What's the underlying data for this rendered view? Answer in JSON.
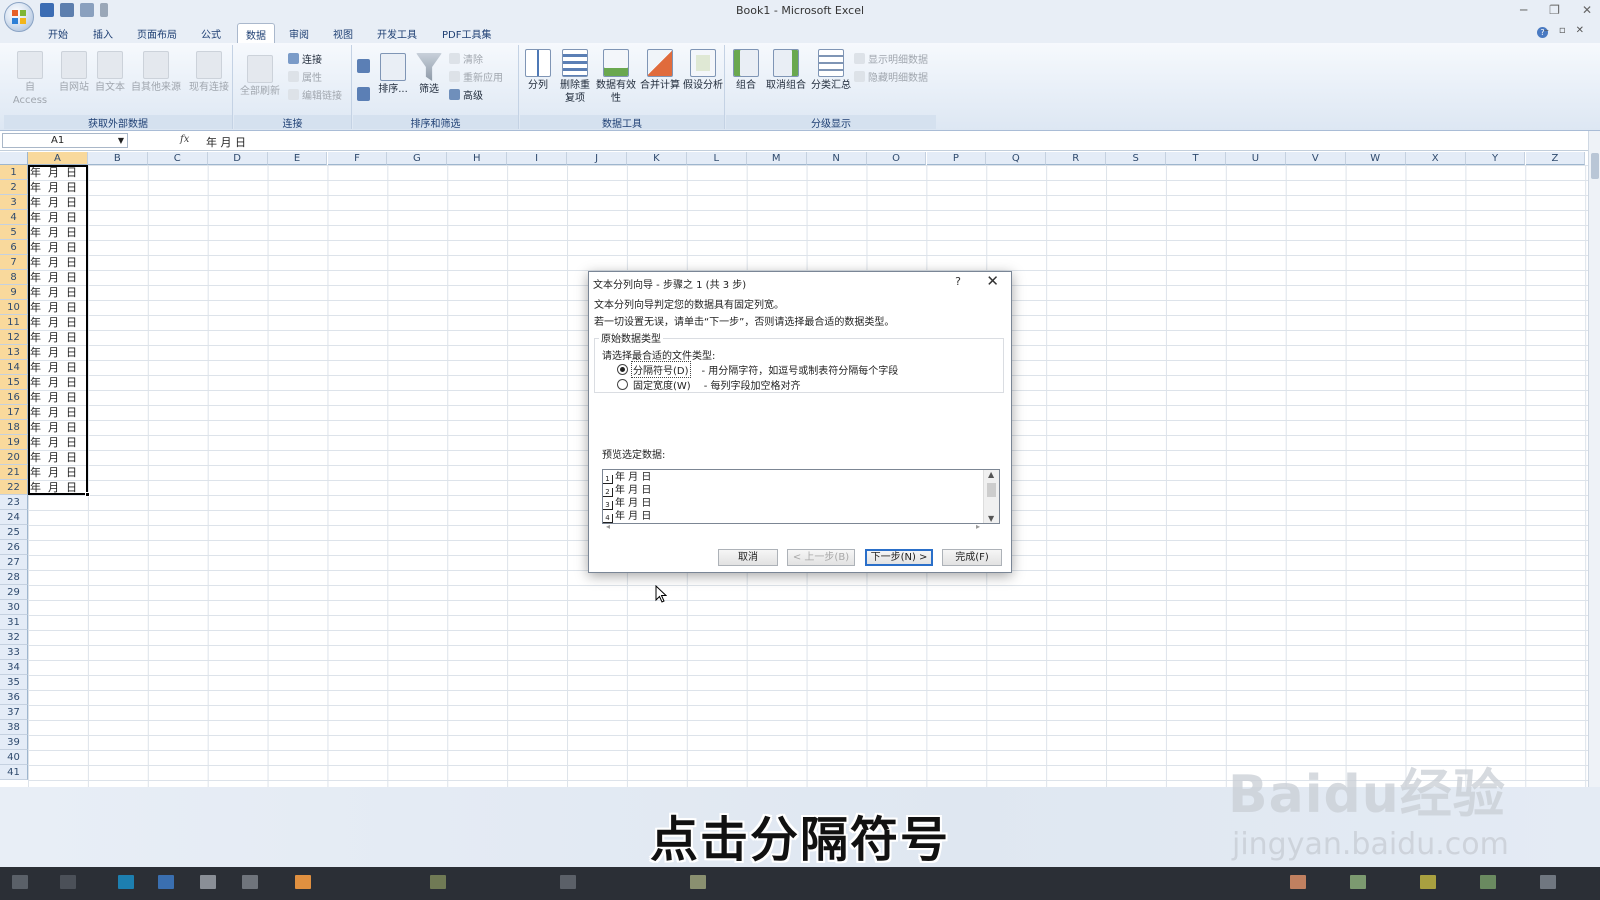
{
  "window": {
    "title": "Book1 - Microsoft Excel"
  },
  "ribbon_tabs": [
    "开始",
    "插入",
    "页面布局",
    "公式",
    "数据",
    "审阅",
    "视图",
    "开发工具",
    "PDF工具集"
  ],
  "active_tab": "数据",
  "ribbon": {
    "external": {
      "label": "获取外部数据",
      "buttons": [
        "自 Access",
        "自网站",
        "自文本",
        "自其他来源",
        "现有连接"
      ]
    },
    "connections": {
      "label": "连接",
      "refresh_all": "全部刷新",
      "items": [
        "连接",
        "属性",
        "编辑链接"
      ]
    },
    "sort_filter": {
      "label": "排序和筛选",
      "sort": "排序...",
      "filter": "筛选",
      "items": [
        "清除",
        "重新应用",
        "高级"
      ]
    },
    "data_tools": {
      "label": "数据工具",
      "buttons": [
        "分列",
        "删除重复项",
        "数据有效性",
        "合并计算",
        "假设分析"
      ]
    },
    "outline": {
      "label": "分级显示",
      "buttons": [
        "组合",
        "取消组合",
        "分类汇总"
      ],
      "items": [
        "显示明细数据",
        "隐藏明细数据"
      ]
    }
  },
  "formula_bar": {
    "name_box": "A1",
    "fx": "fx",
    "content": "年 月 日"
  },
  "columns": [
    "A",
    "B",
    "C",
    "D",
    "E",
    "F",
    "G",
    "H",
    "I",
    "J",
    "K",
    "L",
    "M",
    "N",
    "O",
    "P",
    "Q",
    "R",
    "S",
    "T",
    "U",
    "V",
    "W",
    "X",
    "Y",
    "Z"
  ],
  "rows": [
    "1",
    "2",
    "3",
    "4",
    "5",
    "6",
    "7",
    "8",
    "9",
    "10",
    "11",
    "12",
    "13",
    "14",
    "15",
    "16",
    "17",
    "18",
    "19",
    "20",
    "21",
    "22",
    "23",
    "24",
    "25",
    "26",
    "27",
    "28",
    "29",
    "30",
    "31",
    "32",
    "33",
    "34",
    "35",
    "36",
    "37",
    "38",
    "39",
    "40",
    "41"
  ],
  "cell_parts": [
    "年",
    "月",
    "日"
  ],
  "filled_rows": 22,
  "dialog": {
    "title": "文本分列向导 - 步骤之 1 (共 3 步)",
    "help": "?",
    "close": "✕",
    "line1": "文本分列向导判定您的数据具有固定列宽。",
    "line2": "若一切设置无误，请单击“下一步”，否则请选择最合适的数据类型。",
    "group_label": "原始数据类型",
    "prompt": "请选择最合适的文件类型:",
    "option1": {
      "label": "分隔符号(D)",
      "desc": "- 用分隔字符，如逗号或制表符分隔每个字段",
      "selected": true
    },
    "option2": {
      "label": "固定宽度(W)",
      "desc": "- 每列字段加空格对齐",
      "selected": false
    },
    "preview_label": "预览选定数据:",
    "preview_rows": [
      "年 月 日",
      "年 月 日",
      "年 月 日",
      "年 月 日"
    ],
    "buttons": {
      "cancel": "取消",
      "back": "< 上一步(B)",
      "next": "下一步(N) >",
      "finish": "完成(F)"
    }
  },
  "subtitle": "点击分隔符号",
  "watermark": {
    "line1": "Baidu经验",
    "line2": "jingyan.baidu.com"
  }
}
